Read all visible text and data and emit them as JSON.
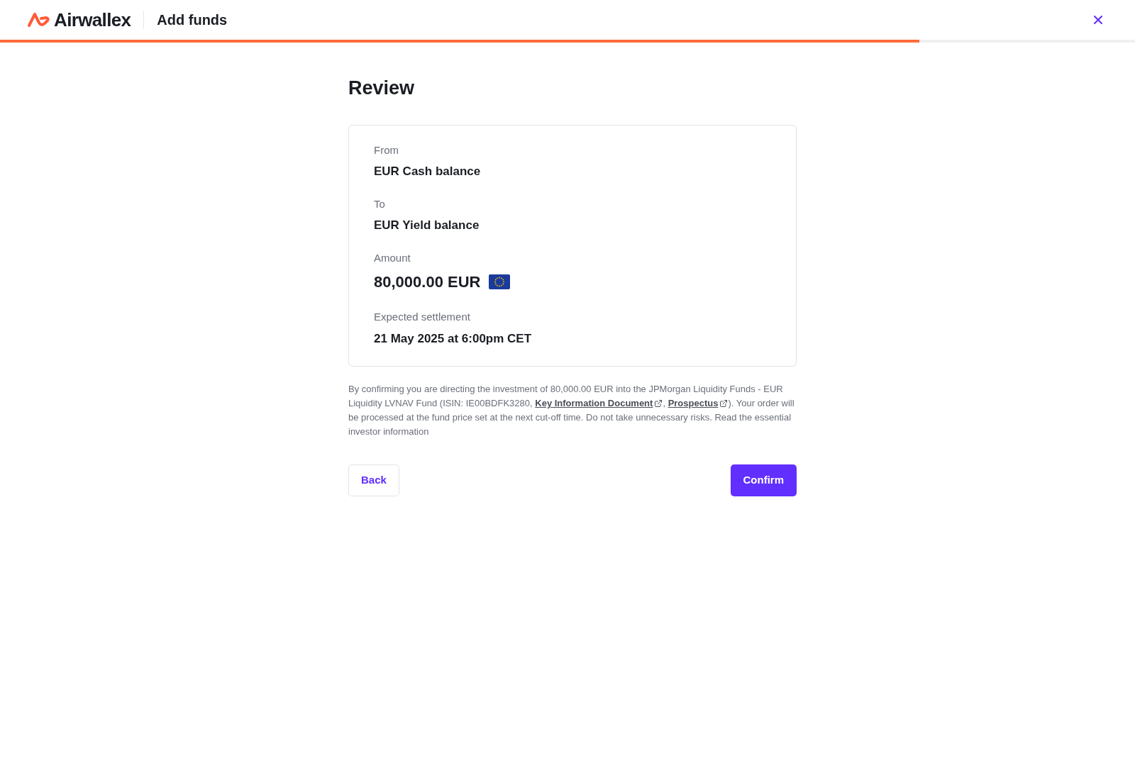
{
  "header": {
    "brand": "Airwallex",
    "title": "Add funds"
  },
  "progress": {
    "level": 0.81
  },
  "page_title": "Review",
  "fields": [
    {
      "kind": "text",
      "label": "From",
      "value": "EUR Cash balance"
    },
    {
      "kind": "text",
      "label": "To",
      "value": "EUR Yield balance"
    },
    {
      "kind": "amount",
      "label": "Amount",
      "value": "80,000.00 EUR"
    },
    {
      "kind": "text",
      "label": "Expected settlement",
      "value": "21 May 2025 at 6:00pm CET"
    }
  ],
  "disclaimer": {
    "before": "By confirming you are directing the investment of 80,000.00 EUR into the JPMorgan Liquidity Funds - EUR Liquidity LVNAV Fund (ISIN: IE00BDFK3280, ",
    "links": [
      {
        "label": "Key Information Document",
        "after": ", "
      },
      {
        "label": "Prospectus",
        "after": "). Your order will be processed at the fund price set at the next cut-off time. Do not take unnecessary risks. Read the essential investor information"
      }
    ]
  },
  "buttons": {
    "back": "Back",
    "confirm": "Confirm"
  }
}
